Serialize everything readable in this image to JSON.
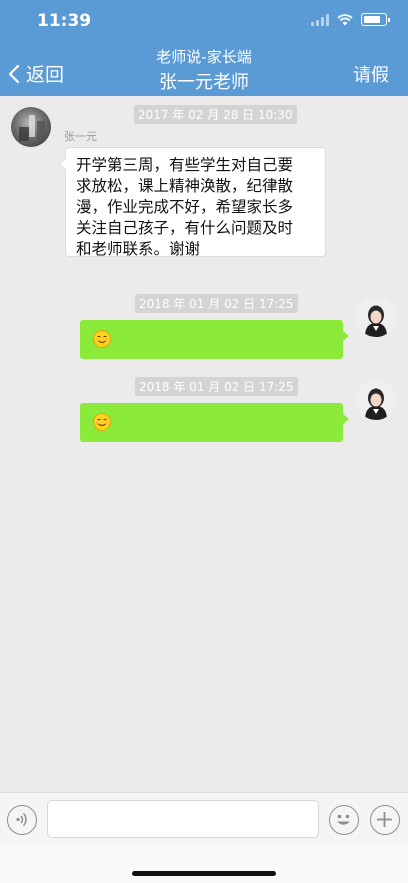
{
  "status": {
    "time": "11:39"
  },
  "header": {
    "back_label": "返回",
    "subtitle": "老师说-家长端",
    "title": "张一元老师",
    "action_label": "请假"
  },
  "messages": [
    {
      "direction": "incoming",
      "timestamp": "2017 年 02 月 28 日 10:30",
      "sender": "张一元",
      "text_lines": [
        "开学第三周，有些学生对自己要",
        "求放松，课上精神涣散，纪律散",
        "漫，作业完成不好，希望家长多",
        "关注自己孩子，有什么问题及时",
        "和老师联系。谢谢"
      ]
    },
    {
      "direction": "outgoing",
      "timestamp": "2018 年 01 月 02 日 17:25",
      "content": "smiley-emoji"
    },
    {
      "direction": "outgoing",
      "timestamp": "2018 年 01 月 02 日 17:25",
      "content": "smiley-emoji"
    }
  ],
  "input_bar": {
    "value": "",
    "placeholder": ""
  },
  "colors": {
    "header_bg": "#5b9bd5",
    "outgoing_bubble": "#8ceb3a",
    "chat_bg": "#ebebeb"
  },
  "icons": [
    "back-chevron-icon",
    "voice-icon",
    "emoji-icon",
    "plus-icon",
    "wifi-icon",
    "battery-icon",
    "signal-icon"
  ]
}
